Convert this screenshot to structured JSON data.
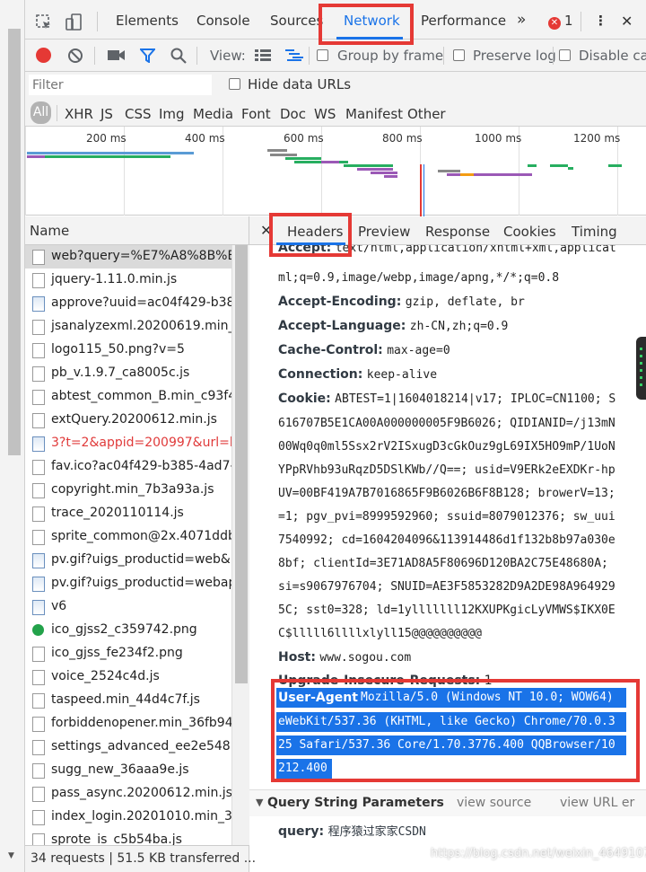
{
  "tabs": [
    "Elements",
    "Console",
    "Sources",
    "Network",
    "Performance"
  ],
  "tabs_more": "»",
  "error_count": "1",
  "toolbar": {
    "view_label": "View:",
    "group_by_frame": "Group by frame",
    "preserve_log": "Preserve log",
    "disable_cache": "Disable cac"
  },
  "filter": {
    "placeholder": "Filter",
    "hide_data_urls": "Hide data URLs"
  },
  "type_filters": [
    "All",
    "XHR",
    "JS",
    "CSS",
    "Img",
    "Media",
    "Font",
    "Doc",
    "WS",
    "Manifest",
    "Other"
  ],
  "timeline_ticks": [
    "200 ms",
    "400 ms",
    "600 ms",
    "800 ms",
    "1000 ms",
    "1200 ms"
  ],
  "list": {
    "header": "Name",
    "items": [
      {
        "name": "web?query=%E7%A8%8B%E5%",
        "icon": "file",
        "selected": true
      },
      {
        "name": "jquery-1.11.0.min.js",
        "icon": "file"
      },
      {
        "name": "approve?uuid=ac04f429-b385",
        "icon": "image"
      },
      {
        "name": "jsanalyzexml.20200619.min_e3",
        "icon": "file"
      },
      {
        "name": "logo115_50.png?v=5",
        "icon": "file"
      },
      {
        "name": "pb_v.1.9.7_ca8005c.js",
        "icon": "file"
      },
      {
        "name": "abtest_common_B.min_c93f4c",
        "icon": "file"
      },
      {
        "name": "extQuery.20200612.min.js",
        "icon": "file"
      },
      {
        "name": "3?t=2&appid=200997&url=ht",
        "icon": "image",
        "error": true
      },
      {
        "name": "fav.ico?ac04f429-b385-4ad7-a",
        "icon": "file"
      },
      {
        "name": "copyright.min_7b3a93a.js",
        "icon": "file"
      },
      {
        "name": "trace_2020110114.js",
        "icon": "file"
      },
      {
        "name": "sprite_common@2x.4071ddb1",
        "icon": "file"
      },
      {
        "name": "pv.gif?uigs_productid=web&u",
        "icon": "image"
      },
      {
        "name": "pv.gif?uigs_productid=webap.",
        "icon": "image"
      },
      {
        "name": "v6",
        "icon": "image"
      },
      {
        "name": "ico_gjss2_c359742.png",
        "icon": "green"
      },
      {
        "name": "ico_gjss_fe234f2.png",
        "icon": "file"
      },
      {
        "name": "voice_2524c4d.js",
        "icon": "file"
      },
      {
        "name": "taspeed.min_44d4c7f.js",
        "icon": "file"
      },
      {
        "name": "forbiddenopener.min_36fb942",
        "icon": "file"
      },
      {
        "name": "settings_advanced_ee2e548.js",
        "icon": "file"
      },
      {
        "name": "sugg_new_36aaa9e.js",
        "icon": "file"
      },
      {
        "name": "pass_async.20200612.min.js",
        "icon": "file"
      },
      {
        "name": "index_login.20201010.min_3a0",
        "icon": "file"
      },
      {
        "name": "sprote_is_c5b54ba.js",
        "icon": "file"
      }
    ]
  },
  "status": "34 requests | 51.5 KB transferred ...",
  "detail_tabs": [
    "Headers",
    "Preview",
    "Response",
    "Cookies",
    "Timing"
  ],
  "headers": [
    {
      "key": "Accept:",
      "value": "text/html,application/xhtml+xml,applicat"
    },
    {
      "key": "",
      "value": "ml;q=0.9,image/webp,image/apng,*/*;q=0.8"
    },
    {
      "key": "Accept-Encoding:",
      "value": "gzip, deflate, br"
    },
    {
      "key": "Accept-Language:",
      "value": "zh-CN,zh;q=0.9"
    },
    {
      "key": "Cache-Control:",
      "value": "max-age=0"
    },
    {
      "key": "Connection:",
      "value": "keep-alive"
    },
    {
      "key": "Cookie:",
      "value": "ABTEST=1|1604018214|v17; IPLOC=CN1100; S"
    },
    {
      "key": "",
      "value": "616707B5E1CA00A000000005F9B6026; QIDIANID=/j13mN"
    },
    {
      "key": "",
      "value": "00Wq0q0ml5Ssx2rV2ISxugD3cGkOuz9gL69IX5HO9mP/1UoN"
    },
    {
      "key": "",
      "value": "YPpRVhb93uRqzD5DSlKWb//Q==; usid=V9ERk2eEXDKr-hp"
    },
    {
      "key": "",
      "value": "UV=00BF419A7B7016865F9B6026B6F8B128; browerV=13;"
    },
    {
      "key": "",
      "value": "=1; pgv_pvi=8999592960; ssuid=8079012376; sw_uui"
    },
    {
      "key": "",
      "value": "7540992; cd=1604204096&113914486d1f132b8b97a030e"
    },
    {
      "key": "",
      "value": "8bf; clientId=3E71AD8A5F80696D120BA2C75E48680A;"
    },
    {
      "key": "",
      "value": "si=s9067976704; SNUID=AE3F5853282D9A2DE98A964929"
    },
    {
      "key": "",
      "value": "5C; sst0=328; ld=1ylllllll12KXUPKgicLyVMWS$IKX0E"
    },
    {
      "key": "",
      "value": "C$lllll6llllxlyll15@@@@@@@@@@"
    },
    {
      "key": "Host:",
      "value": "www.sogou.com"
    },
    {
      "key": "Upgrade-Insecure-Requests:",
      "value": "1"
    }
  ],
  "user_agent": {
    "key": "User-Agent:",
    "lines": [
      "Mozilla/5.0 (Windows NT 10.0; WOW64)",
      "eWebKit/537.36 (KHTML, like Gecko) Chrome/70.0.3",
      "25 Safari/537.36 Core/1.70.3776.400 QQBrowser/10",
      "212.400"
    ]
  },
  "query_section": {
    "title": "Query String Parameters",
    "view_source": "view source",
    "view_url": "view URL er"
  },
  "query_params": [
    {
      "key": "query:",
      "value": "程序猿过家家CSDN"
    }
  ],
  "watermark": "https://blog.csdn.net/weixin_46491071",
  "colors": {
    "accent": "#1a73e8",
    "highlight_box": "#e53935",
    "record": "#e53935"
  }
}
